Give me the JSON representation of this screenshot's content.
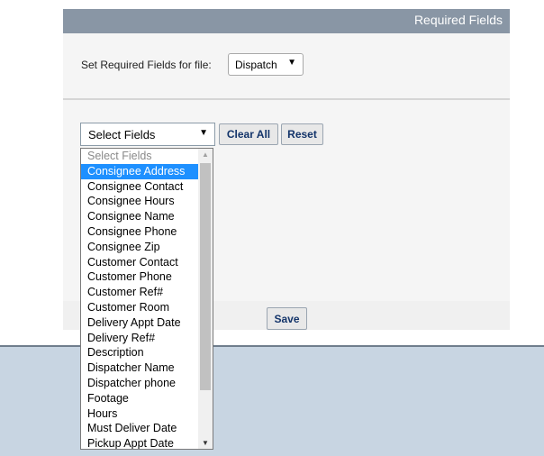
{
  "header": {
    "title": "Required Fields"
  },
  "file_row": {
    "label": "Set Required Fields for file:",
    "selected": "Dispatch"
  },
  "fields_select": {
    "selected": "Select Fields"
  },
  "buttons": {
    "clear_all": "Clear All",
    "reset": "Reset",
    "save": "Save"
  },
  "dropdown": {
    "options": [
      "Select Fields",
      "Consignee Address",
      "Consignee Contact",
      "Consignee Hours",
      "Consignee Name",
      "Consignee Phone",
      "Consignee Zip",
      "Customer Contact",
      "Customer Phone",
      "Customer Ref#",
      "Customer Room",
      "Delivery Appt Date",
      "Delivery Ref#",
      "Description",
      "Dispatcher Name",
      "Dispatcher phone",
      "Footage",
      "Hours",
      "Must Deliver Date",
      "Pickup Appt Date"
    ],
    "highlighted": "Consignee Address",
    "placeholder_option": "Select Fields"
  },
  "icons": {
    "dropdown_arrow": "▼",
    "scroll_up": "▲",
    "scroll_down": "▼"
  },
  "colors": {
    "header_bg": "#8996a5",
    "highlight": "#1e90ff",
    "button_text": "#13346a",
    "page_bottom_bg": "#c8d5e2"
  }
}
